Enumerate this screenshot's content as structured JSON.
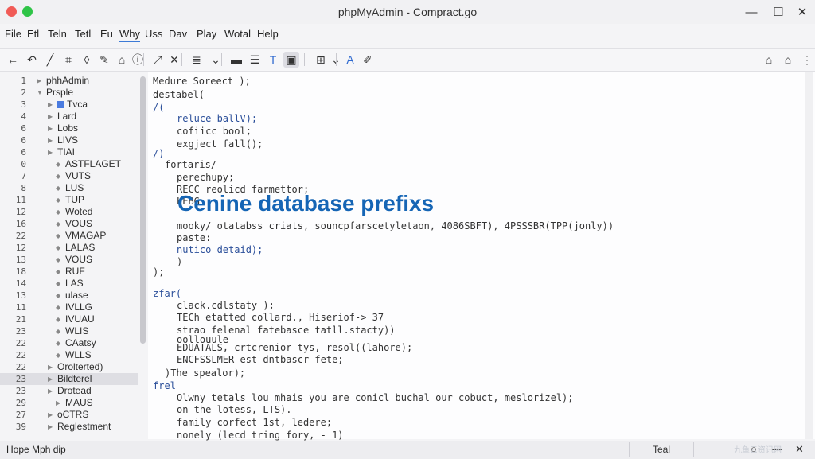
{
  "window": {
    "title": "phpMyAdmin - Compract.go",
    "controls": [
      "—",
      "☐",
      "✕"
    ]
  },
  "menu": [
    {
      "label": "File",
      "active": false
    },
    {
      "label": "Etl",
      "active": false
    },
    {
      "label": "Teln",
      "active": false
    },
    {
      "label": "Tetl",
      "active": false
    },
    {
      "label": "Eu",
      "active": false
    },
    {
      "label": "Why",
      "active": true
    },
    {
      "label": "Uss",
      "active": false
    },
    {
      "label": "Dav",
      "active": false
    },
    {
      "label": "Play",
      "active": false
    },
    {
      "label": "Wotal",
      "active": false
    },
    {
      "label": "Help",
      "active": false
    }
  ],
  "toolbar": {
    "left": [
      {
        "icon": "back-icon",
        "glyph": "←"
      },
      {
        "icon": "undo-icon",
        "glyph": "↶"
      },
      {
        "icon": "line-icon",
        "glyph": "╱"
      },
      {
        "icon": "crop-icon",
        "glyph": "⌗"
      },
      {
        "icon": "eraser-icon",
        "glyph": "◊"
      },
      {
        "icon": "pen-icon",
        "glyph": "✎"
      },
      {
        "icon": "tag-icon",
        "glyph": "⌂"
      },
      {
        "icon": "info-icon",
        "glyph": "ⓘ"
      },
      {
        "icon": "expand-icon",
        "glyph": "⤢"
      },
      {
        "icon": "close-icon",
        "glyph": "✕"
      },
      {
        "icon": "list-icon",
        "glyph": "≣"
      },
      {
        "icon": "chevron-down-icon",
        "glyph": "⌄"
      },
      {
        "icon": "minus-icon",
        "glyph": "▬"
      },
      {
        "icon": "align-icon",
        "glyph": "☰"
      },
      {
        "icon": "text-icon",
        "glyph": "T"
      },
      {
        "icon": "frame-icon",
        "glyph": "▣"
      },
      {
        "icon": "grid-icon",
        "glyph": "⊞"
      },
      {
        "icon": "chevron-down-icon",
        "glyph": "⌄"
      },
      {
        "icon": "font-icon",
        "glyph": "A"
      },
      {
        "icon": "brush-icon",
        "glyph": "✐"
      }
    ],
    "right": [
      {
        "icon": "lock-icon",
        "glyph": "⌂"
      },
      {
        "icon": "home-icon",
        "glyph": "⌂"
      },
      {
        "icon": "more-icon",
        "glyph": "⋮"
      }
    ]
  },
  "tree": [
    {
      "n": "1",
      "label": "phhAdmin",
      "twisty": "▶",
      "indent": 0
    },
    {
      "n": "2",
      "label": "Prsple",
      "twisty": "▼",
      "indent": 0
    },
    {
      "n": "3",
      "label": "Tvca",
      "twisty": "▶",
      "indent": 1,
      "blue": true
    },
    {
      "n": "4",
      "label": "Lard",
      "twisty": "▶",
      "indent": 1
    },
    {
      "n": "6",
      "label": "Lobs",
      "twisty": "▶",
      "indent": 1
    },
    {
      "n": "6",
      "label": "LIVS",
      "twisty": "▶",
      "indent": 1
    },
    {
      "n": "6",
      "label": "TIAI",
      "twisty": "▶",
      "indent": 1
    },
    {
      "n": "0",
      "label": "ASTFLAGET",
      "twisty": "◆",
      "indent": 2
    },
    {
      "n": "7",
      "label": "VUTS",
      "twisty": "◆",
      "indent": 2
    },
    {
      "n": "8",
      "label": "LUS",
      "twisty": "◆",
      "indent": 2
    },
    {
      "n": "11",
      "label": "TUP",
      "twisty": "◆",
      "indent": 2
    },
    {
      "n": "12",
      "label": "Woted",
      "twisty": "◆",
      "indent": 2
    },
    {
      "n": "16",
      "label": "VOUS",
      "twisty": "◆",
      "indent": 2
    },
    {
      "n": "22",
      "label": "VMAGAP",
      "twisty": "◆",
      "indent": 2
    },
    {
      "n": "12",
      "label": "LALAS",
      "twisty": "◆",
      "indent": 2
    },
    {
      "n": "13",
      "label": "VOUS",
      "twisty": "◆",
      "indent": 2
    },
    {
      "n": "18",
      "label": "RUF",
      "twisty": "◆",
      "indent": 2
    },
    {
      "n": "14",
      "label": "LAS",
      "twisty": "◆",
      "indent": 2
    },
    {
      "n": "13",
      "label": "ulase",
      "twisty": "◆",
      "indent": 2
    },
    {
      "n": "11",
      "label": "IVLLG",
      "twisty": "◆",
      "indent": 2
    },
    {
      "n": "21",
      "label": "IVUAU",
      "twisty": "◆",
      "indent": 2
    },
    {
      "n": "23",
      "label": "WLIS",
      "twisty": "◆",
      "indent": 2
    },
    {
      "n": "22",
      "label": "CAatsy",
      "twisty": "◆",
      "indent": 2
    },
    {
      "n": "22",
      "label": "WLLS",
      "twisty": "◆",
      "indent": 2
    },
    {
      "n": "22",
      "label": "Orolterted)",
      "twisty": "▶",
      "indent": 1
    },
    {
      "n": "23",
      "label": "Bildterel",
      "twisty": "▶",
      "indent": 1,
      "selected": true
    },
    {
      "n": "23",
      "label": "Drotead",
      "twisty": "▶",
      "indent": 1
    },
    {
      "n": "29",
      "label": "MAUS",
      "twisty": "▶",
      "indent": 2
    },
    {
      "n": "27",
      "label": "oCTRS",
      "twisty": "▶",
      "indent": 1
    },
    {
      "n": "39",
      "label": "Reglestment",
      "twisty": "▶",
      "indent": 1
    }
  ],
  "code": [
    {
      "text": "Medure Soreect );",
      "indent": 0,
      "kw": false
    },
    {
      "text": "destabel(",
      "indent": 0,
      "kw": false
    },
    {
      "text": "/(",
      "indent": 0,
      "kw": true
    },
    {
      "text": "reluce ballV);",
      "indent": 2,
      "kw": true
    },
    {
      "text": "cofiicc bool;",
      "indent": 2,
      "kw": false
    },
    {
      "text": "exgject fall();",
      "indent": 2,
      "kw": false
    },
    {
      "text": "/)",
      "indent": 0,
      "kw": true
    },
    {
      "text": "fortaris/",
      "indent": 1,
      "kw": false
    },
    {
      "text": "perechupy;",
      "indent": 2,
      "kw": false
    },
    {
      "text": "RECC reolicd farmettor;",
      "indent": 2,
      "kw": false
    },
    {
      "text": "LEBG",
      "indent": 2,
      "kw": false
    },
    {
      "text": "mooky/ otatabss criats, souncpfarscetyletaon, 4086SBFT), 4PSSSBR(TPP(jonly))",
      "indent": 2,
      "kw": false
    },
    {
      "text": "paste:",
      "indent": 2,
      "kw": false
    },
    {
      "text": "nutico detaid);",
      "indent": 2,
      "kw": true
    },
    {
      "text": ")",
      "indent": 2,
      "kw": false
    },
    {
      "text": ");",
      "indent": 0,
      "kw": false
    },
    {
      "text": "",
      "indent": 0,
      "kw": false
    },
    {
      "text": "zfar(",
      "indent": 0,
      "kw": true
    },
    {
      "text": "clack.cdlstaty );",
      "indent": 2,
      "kw": false
    },
    {
      "text": "TECh etatted collard., Hiseriof-> 37",
      "indent": 2,
      "kw": false
    },
    {
      "text": "strao felenal fatebasce tatll.stacty))",
      "indent": 2,
      "kw": false
    },
    {
      "text": "oollouule",
      "indent": 2,
      "kw": false
    },
    {
      "text": "EDUATALS, crtcrenior tys, resol((lahore);",
      "indent": 2,
      "kw": false
    },
    {
      "text": "ENCFSSLMER est dntbascr fete;",
      "indent": 2,
      "kw": false
    },
    {
      "text": ")The spealor);",
      "indent": 1,
      "kw": false
    },
    {
      "text": "frel",
      "indent": 0,
      "kw": true
    },
    {
      "text": "Olwny tetals lou mhais you are conicl buchal our cobuct, meslorizel);",
      "indent": 2,
      "kw": false
    },
    {
      "text": "on the lotess, LTS).",
      "indent": 2,
      "kw": false
    },
    {
      "text": "family corfect 1st, ledere;",
      "indent": 2,
      "kw": false
    },
    {
      "text": "nonely (lecd tring fory, - 1)",
      "indent": 2,
      "kw": false
    }
  ],
  "overlay": "Cenine database prefixs",
  "status": {
    "left": "Hope Mph dip",
    "mode": "Teal",
    "controls": [
      "○",
      "—",
      "✕"
    ]
  },
  "watermark": "九鱼云资讯网"
}
